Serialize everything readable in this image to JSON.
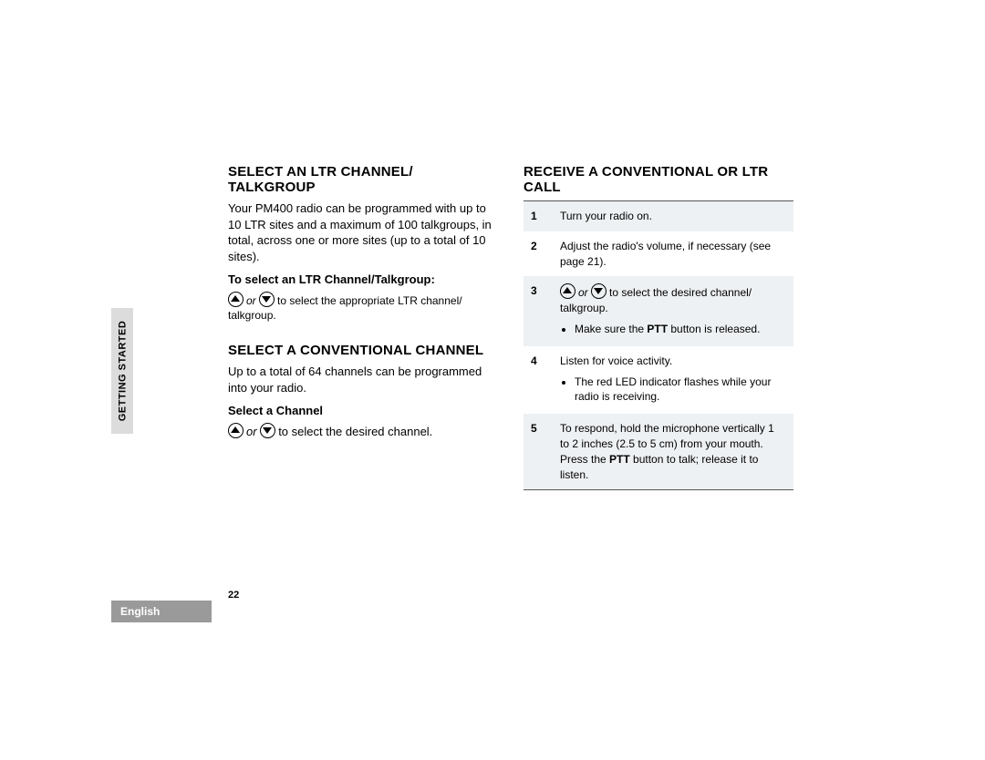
{
  "sidebar": {
    "section": "Getting Started",
    "language": "English"
  },
  "page_number": "22",
  "left": {
    "h1": "SELECT AN LTR CHANNEL/ TALKGROUP",
    "p1": "Your PM400 radio can be programmed with up to 10 LTR sites and a maximum of 100 talkgroups, in total, across one or more sites (up to a total of 10 sites).",
    "sub1": "To select an LTR Channel/Talkgroup:",
    "or1": "or",
    "instr1": "to select the appropriate LTR channel/ talkgroup.",
    "h2": "SELECT A CONVENTIONAL CHANNEL",
    "p2": "Up to a total of 64 channels can be programmed into your radio.",
    "sub2": "Select a Channel",
    "or2": "or",
    "instr2": "to select the desired channel."
  },
  "right": {
    "h1": "RECEIVE A CONVENTIONAL OR LTR CALL",
    "steps": [
      {
        "n": "1",
        "text": "Turn your radio on."
      },
      {
        "n": "2",
        "text": "Adjust the radio's volume, if necessary (see page 21)."
      },
      {
        "n": "3",
        "arrows": true,
        "or": "or",
        "after": "to select the desired channel/ talkgroup.",
        "bullets": [
          {
            "pre": "Make sure the ",
            "bold": "PTT",
            "post": " button is released."
          }
        ]
      },
      {
        "n": "4",
        "text": "Listen for voice activity.",
        "bullets2": [
          "The red LED indicator flashes while your radio is receiving."
        ]
      },
      {
        "n": "5",
        "line1": "To respond, hold the microphone vertically 1 to 2 inches (2.5 to 5 cm) from your mouth.",
        "line2pre": "Press the ",
        "line2bold": "PTT",
        "line2post": " button to talk; release it to listen."
      }
    ]
  }
}
